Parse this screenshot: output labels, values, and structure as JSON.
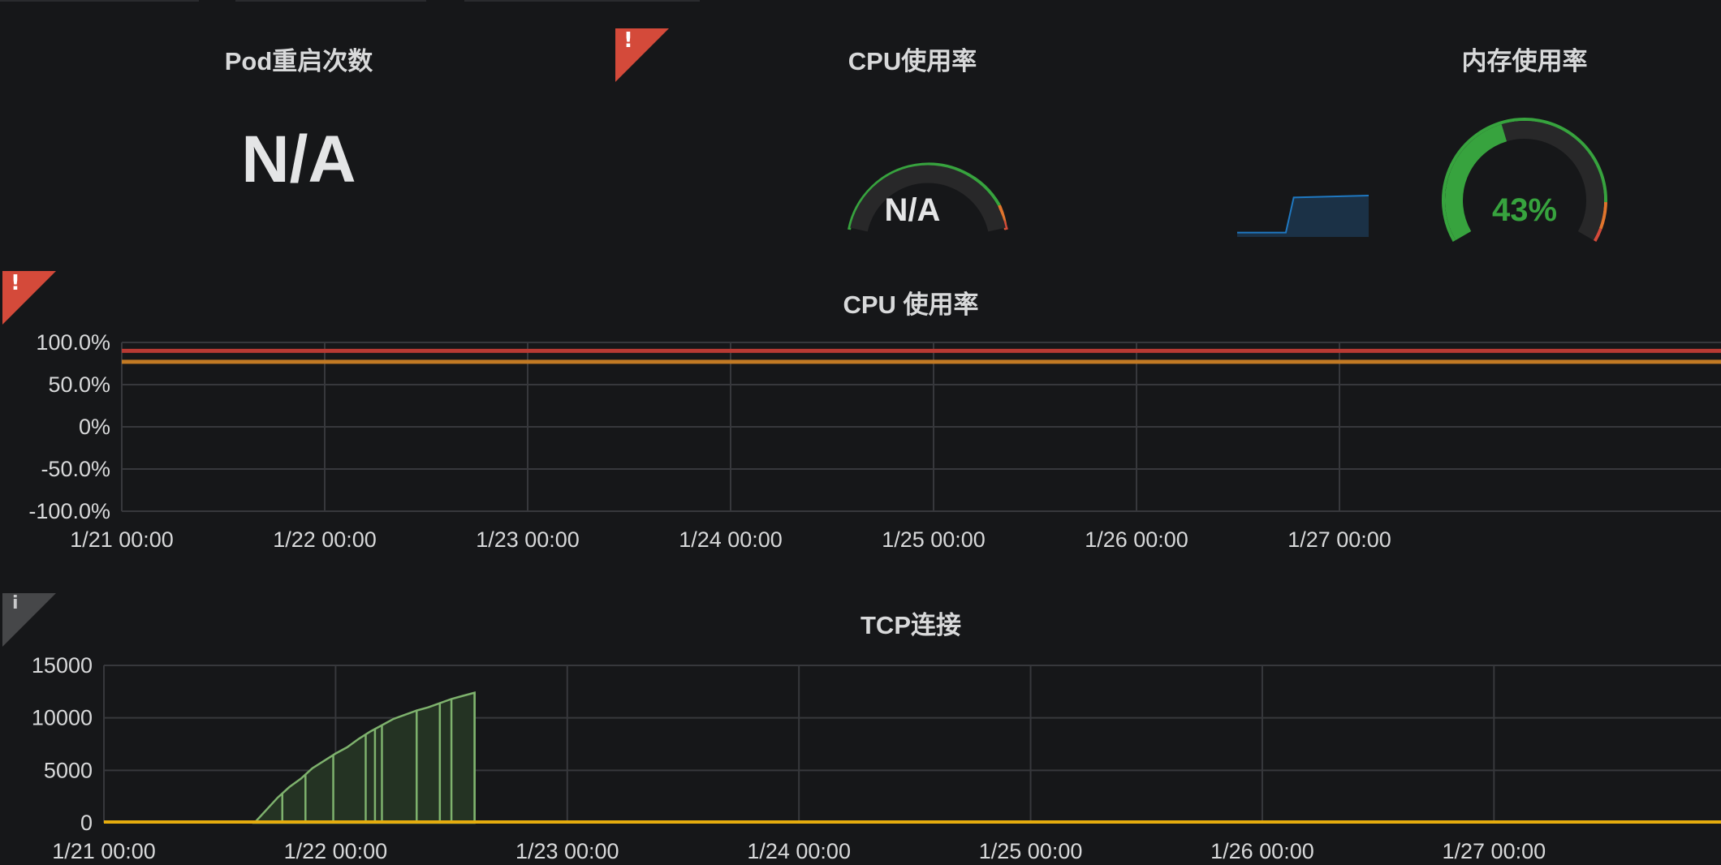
{
  "panels": {
    "restarts": {
      "title": "Pod重启次数",
      "value": "N/A"
    },
    "cpu_gauge": {
      "title": "CPU使用率",
      "value": "N/A",
      "alert_icon": "alert-icon",
      "fraction": null
    },
    "mem_gauge": {
      "title": "内存使用率",
      "value": "43%",
      "fraction": 0.43
    },
    "cpu_graph": {
      "title": "CPU 使用率",
      "alert_icon": "alert-icon"
    },
    "tcp_graph": {
      "title": "TCP连接",
      "info_icon": "info-icon"
    }
  },
  "colors": {
    "background": "#161719",
    "grid": "#37383c",
    "threshold_red": "#b83a33",
    "threshold_orange": "#c27a24",
    "gauge_green": "#37a33e",
    "gauge_orange": "#e0752d",
    "gauge_red": "#d44a3a",
    "sparkline": "#1f78c1",
    "tcp_series": "#7eb26d",
    "tcp_baseline": "#e5ac0e",
    "alert_corner": "#d44a3a",
    "info_corner": "#464749"
  },
  "chart_data": [
    {
      "type": "line",
      "title": "CPU 使用率",
      "x_ticks": [
        "1/21 00:00",
        "1/22 00:00",
        "1/23 00:00",
        "1/24 00:00",
        "1/25 00:00",
        "1/26 00:00",
        "1/27 00:00"
      ],
      "y_ticks": [
        "100.0%",
        "50.0%",
        "0%",
        "-50.0%",
        "-100.0%"
      ],
      "ylim": [
        -100,
        100
      ],
      "thresholds": [
        {
          "value": 90,
          "color": "#b83a33"
        },
        {
          "value": 77,
          "color": "#c27a24"
        }
      ],
      "series": [],
      "grid": true
    },
    {
      "type": "line",
      "title": "TCP连接",
      "x_ticks": [
        "1/21 00:00",
        "1/22 00:00",
        "1/23 00:00",
        "1/24 00:00",
        "1/25 00:00",
        "1/26 00:00",
        "1/27 00:00"
      ],
      "y_ticks": [
        "15000",
        "10000",
        "5000",
        "0"
      ],
      "ylim": [
        0,
        15000
      ],
      "x_unit": "days",
      "series": [
        {
          "color": "#7eb26d",
          "fill": true,
          "points": [
            [
              0.65,
              0
            ],
            [
              0.75,
              2400
            ],
            [
              0.8,
              3400
            ],
            [
              0.85,
              4200
            ],
            [
              0.9,
              5200
            ],
            [
              0.95,
              5900
            ],
            [
              1.0,
              6600
            ],
            [
              1.05,
              7200
            ],
            [
              1.1,
              8000
            ],
            [
              1.15,
              8700
            ],
            [
              1.2,
              9300
            ],
            [
              1.25,
              9900
            ],
            [
              1.3,
              10300
            ],
            [
              1.35,
              10700
            ],
            [
              1.4,
              11000
            ],
            [
              1.45,
              11400
            ],
            [
              1.5,
              11800
            ],
            [
              1.55,
              12100
            ],
            [
              1.6,
              12400
            ],
            [
              1.6,
              0
            ]
          ],
          "drops": [
            0.77,
            0.87,
            0.99,
            1.13,
            1.17,
            1.2,
            1.35,
            1.45,
            1.5,
            1.6
          ]
        },
        {
          "color": "#e5ac0e",
          "constant": 0
        }
      ],
      "grid": true
    }
  ],
  "sparkline": {
    "points": [
      [
        0,
        0.05
      ],
      [
        0.37,
        0.05
      ],
      [
        0.43,
        0.95
      ],
      [
        1,
        1
      ]
    ]
  }
}
